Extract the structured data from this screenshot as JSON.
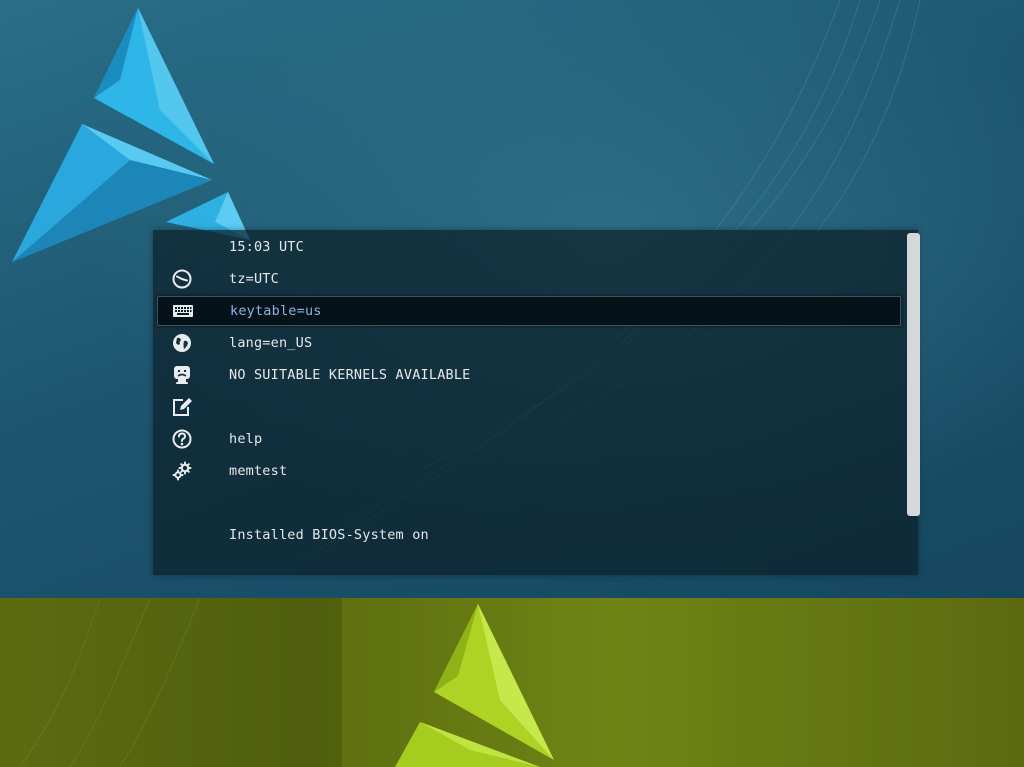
{
  "boot_menu": {
    "items": [
      {
        "label": "15:03 UTC",
        "icon": "none"
      },
      {
        "label": "tz=UTC",
        "icon": "clock-icon"
      },
      {
        "label": "keytable=us",
        "icon": "keyboard-icon",
        "selected": true
      },
      {
        "label": "lang=en_US",
        "icon": "globe-icon"
      },
      {
        "label": "NO SUITABLE KERNELS AVAILABLE",
        "icon": "sad-monitor-icon"
      },
      {
        "label": "",
        "icon": "edit-icon"
      },
      {
        "label": "help",
        "icon": "help-icon"
      },
      {
        "label": "memtest",
        "icon": "gears-icon"
      },
      {
        "label": "",
        "icon": "none"
      },
      {
        "label": "Installed BIOS-System on",
        "icon": "none"
      }
    ]
  },
  "colors": {
    "background_top": "#1d5570",
    "background_bottom": "#6f7e15",
    "panel": "#0c202a",
    "selected_text": "#8fb0e8",
    "text": "#e6e9ea",
    "logo_blue": "#27a7dc",
    "logo_green": "#b4d82a",
    "scrollbar": "#d4d8da"
  }
}
